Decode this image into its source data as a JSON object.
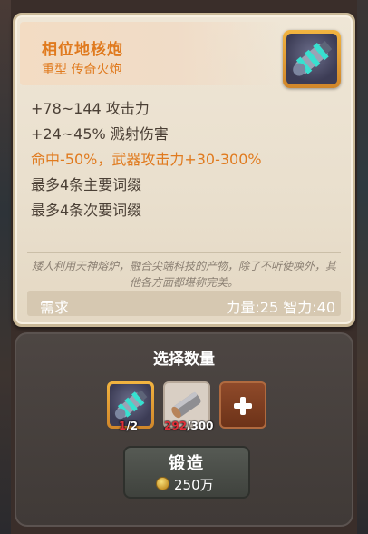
{
  "item": {
    "name": "相位地核炮",
    "type": "重型 传奇火炮",
    "stats": [
      "+78~144 攻击力",
      "+24~45% 溅射伤害"
    ],
    "special": "命中-50%，武器攻击力+30-300%",
    "affixes": [
      "最多4条主要词缀",
      "最多4条次要词缀"
    ],
    "flavor": "矮人利用天神熔炉，融合尖端科技的产物，除了不听使唤外，其他各方面都堪称完美。",
    "requirement_label": "需求",
    "requirement_values": "力量:25 智力:40"
  },
  "forge": {
    "title": "选择数量",
    "weapon_count_have": "1",
    "weapon_count_need": "/2",
    "material_count_have": "292",
    "material_count_need": "/300",
    "button_label": "锻造",
    "cost": "250万"
  },
  "colors": {
    "accent_orange": "#e07a1e",
    "insufficient_red": "#e0303a"
  },
  "icons": [
    "cannon-icon",
    "metal-bar-icon",
    "plus-icon",
    "coin-icon"
  ]
}
